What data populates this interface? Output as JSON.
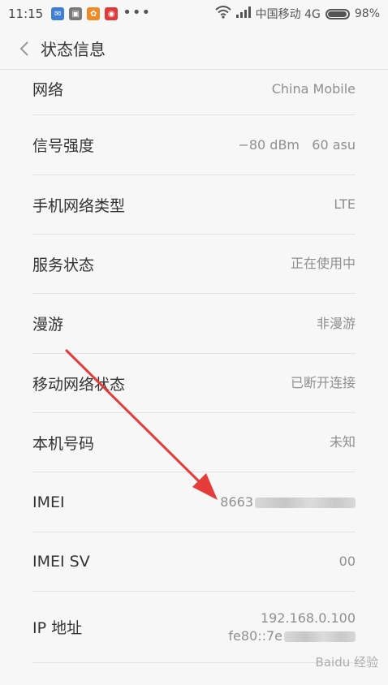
{
  "status_bar": {
    "time": "11:15",
    "dots": "•••",
    "carrier": "中国移动 4G",
    "battery_percent": "98%",
    "battery_level": 0.98,
    "icons": [
      "app-icon-blue",
      "app-icon-gray",
      "app-icon-orange",
      "app-icon-red",
      "wifi-icon",
      "signal-icon",
      "battery-icon"
    ]
  },
  "header": {
    "title": "状态信息"
  },
  "rows": [
    {
      "label": "网络",
      "value": "China Mobile"
    },
    {
      "label": "信号强度",
      "value": "−80 dBm   60 asu"
    },
    {
      "label": "手机网络类型",
      "value": "LTE"
    },
    {
      "label": "服务状态",
      "value": "正在使用中"
    },
    {
      "label": "漫游",
      "value": "非漫游"
    },
    {
      "label": "移动网络状态",
      "value": "已断开连接"
    },
    {
      "label": "本机号码",
      "value": "未知"
    },
    {
      "label": "IMEI",
      "value": "8663"
    },
    {
      "label": "IMEI SV",
      "value": "00"
    },
    {
      "label": "IP 地址",
      "value_line1": "192.168.0.100",
      "value_line2": "fe80::7e"
    }
  ],
  "watermark": "Baidu 经验",
  "colors": {
    "background": "#f7f7f7",
    "arrow": "#e53b3b"
  }
}
